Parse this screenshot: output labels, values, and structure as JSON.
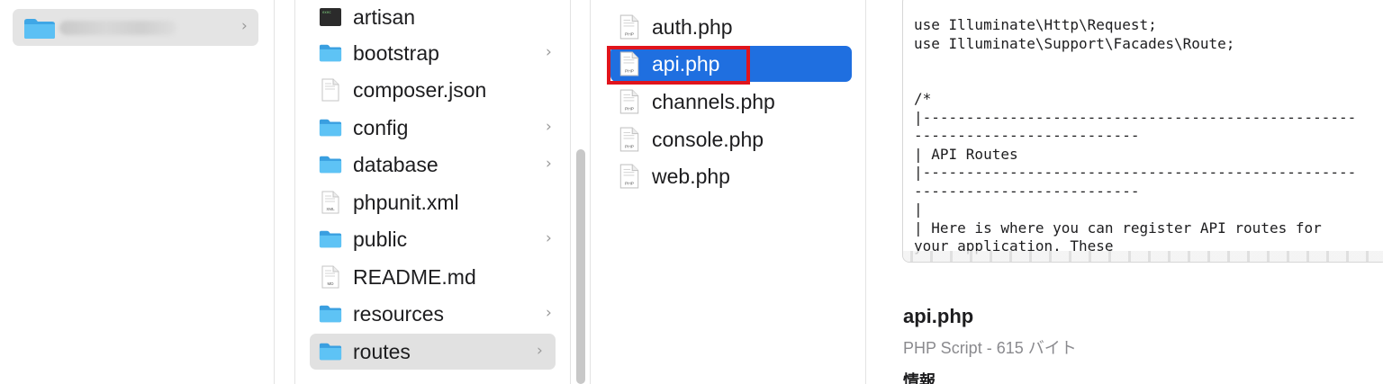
{
  "column1": {
    "item_label": "",
    "chevron": "›"
  },
  "column2": {
    "items": [
      {
        "label": "artisan",
        "icon": "terminal-icon",
        "folder": false
      },
      {
        "label": "bootstrap",
        "icon": "folder-icon",
        "folder": true
      },
      {
        "label": "composer.json",
        "icon": "document-icon",
        "folder": false
      },
      {
        "label": "config",
        "icon": "folder-icon",
        "folder": true
      },
      {
        "label": "database",
        "icon": "folder-icon",
        "folder": true
      },
      {
        "label": "phpunit.xml",
        "icon": "document-icon",
        "folder": false,
        "badge": "XML"
      },
      {
        "label": "public",
        "icon": "folder-icon",
        "folder": true
      },
      {
        "label": "README.md",
        "icon": "document-icon",
        "folder": false,
        "badge": "MD"
      },
      {
        "label": "resources",
        "icon": "folder-icon",
        "folder": true
      },
      {
        "label": "routes",
        "icon": "folder-icon",
        "folder": true,
        "selected": true
      }
    ],
    "chevron": "›"
  },
  "column3": {
    "items": [
      {
        "label": "auth.php",
        "badge": "PHP"
      },
      {
        "label": "api.php",
        "badge": "PHP",
        "selected": true
      },
      {
        "label": "channels.php",
        "badge": "PHP"
      },
      {
        "label": "console.php",
        "badge": "PHP"
      },
      {
        "label": "web.php",
        "badge": "PHP"
      }
    ],
    "selection_color": "#1f6fe0",
    "highlight_color": "#e0141c"
  },
  "preview": {
    "code_lines": [
      "use Illuminate\\Http\\Request;",
      "use Illuminate\\Support\\Facades\\Route;",
      "",
      "",
      "/*",
      "|--------------------------------------------------",
      "--------------------------",
      "| API Routes",
      "|--------------------------------------------------",
      "--------------------------",
      "|",
      "| Here is where you can register API routes for",
      "your application. These"
    ],
    "file_name": "api.php",
    "file_info": "PHP Script - 615 バイト",
    "info_heading": "情報"
  }
}
